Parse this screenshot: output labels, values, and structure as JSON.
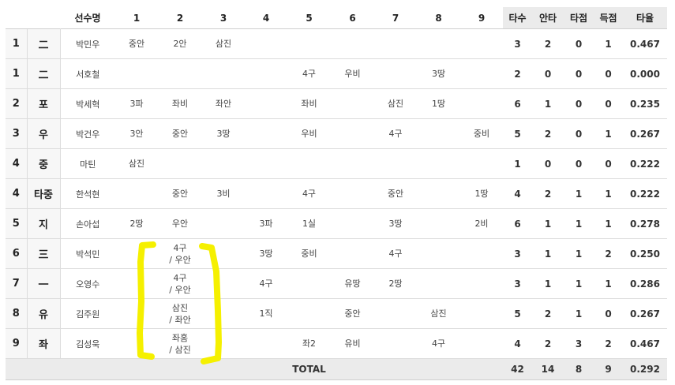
{
  "headers": [
    "",
    "",
    "선수명",
    "1",
    "2",
    "3",
    "4",
    "5",
    "6",
    "7",
    "8",
    "9",
    "타수",
    "안타",
    "타점",
    "득점",
    "타율"
  ],
  "rows": [
    {
      "order": "1",
      "pos": "二",
      "name": "박민우",
      "inn": [
        "중안",
        "2안",
        "삼진",
        "",
        "",
        "",
        "",
        "",
        ""
      ],
      "ab": "3",
      "h": "2",
      "rbi": "0",
      "r": "1",
      "avg": "0.467"
    },
    {
      "order": "1",
      "pos": "二",
      "name": "서호철",
      "inn": [
        "",
        "",
        "",
        "",
        "4구",
        "우비",
        "",
        "3땅",
        ""
      ],
      "ab": "2",
      "h": "0",
      "rbi": "0",
      "r": "0",
      "avg": "0.000"
    },
    {
      "order": "2",
      "pos": "포",
      "name": "박세혁",
      "inn": [
        "3파",
        "좌비",
        "좌안",
        "",
        "좌비",
        "",
        "삼진",
        "1땅",
        ""
      ],
      "ab": "6",
      "h": "1",
      "rbi": "0",
      "r": "0",
      "avg": "0.235"
    },
    {
      "order": "3",
      "pos": "우",
      "name": "박건우",
      "inn": [
        "3안",
        "중안",
        "3땅",
        "",
        "우비",
        "",
        "4구",
        "",
        "중비"
      ],
      "ab": "5",
      "h": "2",
      "rbi": "0",
      "r": "1",
      "avg": "0.267"
    },
    {
      "order": "4",
      "pos": "중",
      "name": "마틴",
      "inn": [
        "삼진",
        "",
        "",
        "",
        "",
        "",
        "",
        "",
        ""
      ],
      "ab": "1",
      "h": "0",
      "rbi": "0",
      "r": "0",
      "avg": "0.222"
    },
    {
      "order": "4",
      "pos": "타중",
      "name": "한석현",
      "inn": [
        "",
        "중안",
        "3비",
        "",
        "4구",
        "",
        "중안",
        "",
        "1땅"
      ],
      "ab": "4",
      "h": "2",
      "rbi": "1",
      "r": "1",
      "avg": "0.222"
    },
    {
      "order": "5",
      "pos": "지",
      "name": "손아섭",
      "inn": [
        "2땅",
        "우안",
        "",
        "3파",
        "1실",
        "",
        "3땅",
        "",
        "2비"
      ],
      "ab": "6",
      "h": "1",
      "rbi": "1",
      "r": "1",
      "avg": "0.278"
    },
    {
      "order": "6",
      "pos": "三",
      "name": "박석민",
      "inn": [
        "",
        "4구\n/ 우안",
        "",
        "3땅",
        "중비",
        "",
        "4구",
        "",
        ""
      ],
      "ab": "3",
      "h": "1",
      "rbi": "1",
      "r": "2",
      "avg": "0.250"
    },
    {
      "order": "7",
      "pos": "一",
      "name": "오영수",
      "inn": [
        "",
        "4구\n/ 우안",
        "",
        "4구",
        "",
        "유땅",
        "2땅",
        "",
        ""
      ],
      "ab": "3",
      "h": "1",
      "rbi": "1",
      "r": "1",
      "avg": "0.286"
    },
    {
      "order": "8",
      "pos": "유",
      "name": "김주원",
      "inn": [
        "",
        "삼진\n/ 좌안",
        "",
        "1직",
        "",
        "중안",
        "",
        "삼진",
        ""
      ],
      "ab": "5",
      "h": "2",
      "rbi": "1",
      "r": "0",
      "avg": "0.267"
    },
    {
      "order": "9",
      "pos": "좌",
      "name": "김성욱",
      "inn": [
        "",
        "좌홈\n/ 삼진",
        "",
        "",
        "좌2",
        "유비",
        "",
        "4구",
        ""
      ],
      "ab": "4",
      "h": "2",
      "rbi": "3",
      "r": "2",
      "avg": "0.467"
    }
  ],
  "total": {
    "label": "TOTAL",
    "ab": "42",
    "h": "14",
    "rbi": "8",
    "r": "9",
    "avg": "0.292"
  },
  "colors": {
    "header_gray": "#ebebeb",
    "highlight": "#f5f000"
  }
}
